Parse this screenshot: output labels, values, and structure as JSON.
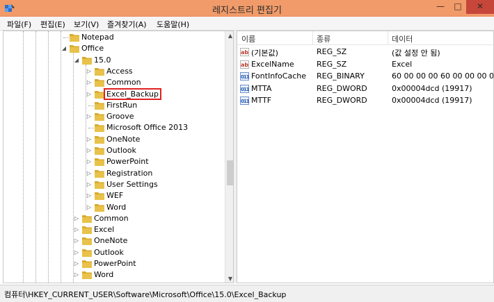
{
  "window": {
    "title": "레지스트리 편집기",
    "minimize_glyph": "—",
    "maximize_glyph": "□",
    "close_glyph": "✕",
    "app_icon": "regedit-icon"
  },
  "menu": {
    "items": [
      "파일(F)",
      "편집(E)",
      "보기(V)",
      "즐겨찾기(A)",
      "도움말(H)"
    ]
  },
  "tree": {
    "rows": [
      {
        "label": "Notepad",
        "depth": 0,
        "expander": "",
        "expanded": false
      },
      {
        "label": "Office",
        "depth": 0,
        "expander": "◢",
        "expanded": true
      },
      {
        "label": "15.0",
        "depth": 1,
        "expander": "◢",
        "expanded": true
      },
      {
        "label": "Access",
        "depth": 2,
        "expander": "▷",
        "expanded": false
      },
      {
        "label": "Common",
        "depth": 2,
        "expander": "▷",
        "expanded": false
      },
      {
        "label": "Excel_Backup",
        "depth": 2,
        "expander": "▷",
        "expanded": false,
        "selected": true
      },
      {
        "label": "FirstRun",
        "depth": 2,
        "expander": "",
        "expanded": false
      },
      {
        "label": "Groove",
        "depth": 2,
        "expander": "▷",
        "expanded": false
      },
      {
        "label": "Microsoft Office 2013",
        "depth": 2,
        "expander": "",
        "expanded": false
      },
      {
        "label": "OneNote",
        "depth": 2,
        "expander": "▷",
        "expanded": false
      },
      {
        "label": "Outlook",
        "depth": 2,
        "expander": "▷",
        "expanded": false
      },
      {
        "label": "PowerPoint",
        "depth": 2,
        "expander": "▷",
        "expanded": false
      },
      {
        "label": "Registration",
        "depth": 2,
        "expander": "▷",
        "expanded": false
      },
      {
        "label": "User Settings",
        "depth": 2,
        "expander": "▷",
        "expanded": false
      },
      {
        "label": "WEF",
        "depth": 2,
        "expander": "▷",
        "expanded": false
      },
      {
        "label": "Word",
        "depth": 2,
        "expander": "▷",
        "expanded": false
      },
      {
        "label": "Common",
        "depth": 1,
        "expander": "▷",
        "expanded": false
      },
      {
        "label": "Excel",
        "depth": 1,
        "expander": "▷",
        "expanded": false
      },
      {
        "label": "OneNote",
        "depth": 1,
        "expander": "▷",
        "expanded": false
      },
      {
        "label": "Outlook",
        "depth": 1,
        "expander": "▷",
        "expanded": false
      },
      {
        "label": "PowerPoint",
        "depth": 1,
        "expander": "▷",
        "expanded": false
      },
      {
        "label": "Word",
        "depth": 1,
        "expander": "▷",
        "expanded": false
      }
    ]
  },
  "values": {
    "columns": [
      "이름",
      "종류",
      "데이터"
    ],
    "rows": [
      {
        "icon": "ab",
        "name": "(기본값)",
        "type": "REG_SZ",
        "data": "(값 설정 안 됨)"
      },
      {
        "icon": "ab",
        "name": "ExcelName",
        "type": "REG_SZ",
        "data": "Excel"
      },
      {
        "icon": "011",
        "name": "FontInfoCache",
        "type": "REG_BINARY",
        "data": "60 00 00 00 60 00 00 00 00"
      },
      {
        "icon": "011",
        "name": "MTTA",
        "type": "REG_DWORD",
        "data": "0x00004dcd (19917)"
      },
      {
        "icon": "011",
        "name": "MTTF",
        "type": "REG_DWORD",
        "data": "0x00004dcd (19917)"
      }
    ]
  },
  "status": {
    "path": "컴퓨터\\HKEY_CURRENT_USER\\Software\\Microsoft\\Office\\15.0\\Excel_Backup"
  },
  "colors": {
    "titlebar": "#f09b69",
    "close_button": "#c7463a",
    "selection_outline": "#e02020",
    "folder": "#e8c24a"
  }
}
